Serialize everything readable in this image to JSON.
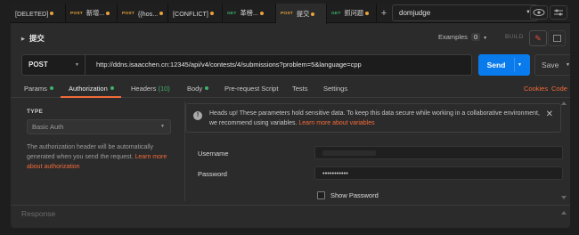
{
  "tabs": [
    {
      "method": "",
      "label": "[DELETED]",
      "dot": "orange"
    },
    {
      "method": "POST",
      "label": "新增...",
      "dot": "orange"
    },
    {
      "method": "POST",
      "label": "{{hos...",
      "dot": "orange"
    },
    {
      "method": "",
      "label": "[CONFLICT]",
      "dot": "orange"
    },
    {
      "method": "GET",
      "label": "革榜...",
      "dot": "orange"
    },
    {
      "method": "POST",
      "label": "提交",
      "dot": "orange"
    },
    {
      "method": "GET",
      "label": "抓问题",
      "dot": "orange"
    }
  ],
  "environment": {
    "selected": "domjudge"
  },
  "request": {
    "name": "提交",
    "examples_label": "Examples",
    "examples_count": "0",
    "build_label": "BUILD",
    "method": "POST",
    "url": "http://ddns.isaacchen.cn:12345/api/v4/contests/4/submissions?problem=5&language=cpp",
    "send_label": "Send",
    "save_label": "Save"
  },
  "request_tabs": {
    "params": "Params",
    "authorization": "Authorization",
    "headers": "Headers",
    "headers_count": "(10)",
    "body": "Body",
    "prerequest": "Pre-request Script",
    "tests": "Tests",
    "settings": "Settings",
    "cookies": "Cookies",
    "code": "Code"
  },
  "auth": {
    "type_label": "TYPE",
    "type_value": "Basic Auth",
    "description": "The authorization header will be automatically generated when you send the request.",
    "learn_more": "Learn more about authorization",
    "notice_text": "Heads up! These parameters hold sensitive data. To keep this data secure while working in a collaborative environment, we recommend using variables.",
    "notice_link": "Learn more about variables",
    "username_label": "Username",
    "password_label": "Password",
    "password_value": "•••••••••••",
    "show_password_label": "Show Password"
  },
  "response": {
    "label": "Response"
  },
  "colors": {
    "accent": "#f26b3a",
    "send": "#097bed",
    "post": "#e8a33a",
    "get": "#3fb36b"
  }
}
